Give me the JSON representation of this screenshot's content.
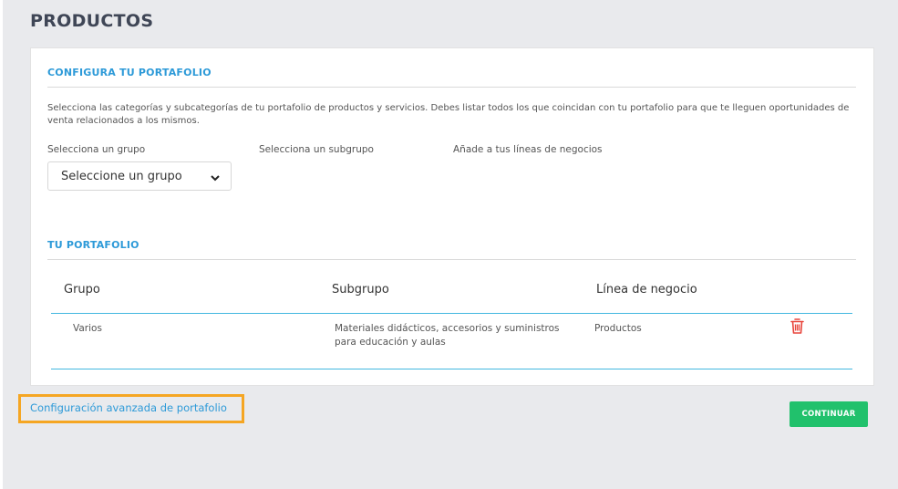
{
  "page_title": "PRODUCTOS",
  "configure": {
    "title": "CONFIGURA TU PORTAFOLIO",
    "description": "Selecciona las categorías y subcategorías de tu portafolio de productos y servicios. Debes listar todos los que coincidan con tu portafolio para que te lleguen oportunidades de venta relacionados a los mismos.",
    "group_label": "Selecciona un grupo",
    "subgroup_label": "Selecciona un subgrupo",
    "lines_label": "Añade a tus líneas de negocios",
    "group_select_value": "Seleccione un grupo"
  },
  "portfolio": {
    "title": "TU PORTAFOLIO",
    "columns": [
      "Grupo",
      "Subgrupo",
      "Línea de negocio"
    ],
    "rows": [
      {
        "grupo": "Varios",
        "subgrupo_line1": "Materiales didácticos, accesorios y suministros",
        "subgrupo_line2": "para educación y aulas",
        "linea": "Productos",
        "action_icon": "trash-icon"
      }
    ]
  },
  "advanced_link": "Configuración avanzada de portafolio",
  "continue_button": "CONTINUAR",
  "colors": {
    "accent": "#2d9ad8",
    "continue": "#21c16c",
    "delete": "#e8453c",
    "highlight": "#f5a623"
  }
}
